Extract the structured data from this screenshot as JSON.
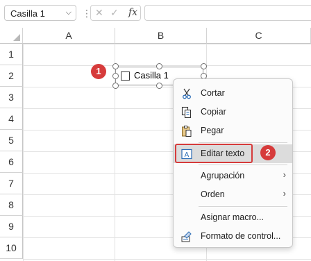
{
  "formula_bar": {
    "name_box": "Casilla 1",
    "separator": "⋮",
    "cancel": "✕",
    "enter": "✓",
    "fx": "fx",
    "formula": ""
  },
  "columns": [
    "A",
    "B",
    "C"
  ],
  "rows": [
    "1",
    "2",
    "3",
    "4",
    "5",
    "6",
    "7",
    "8",
    "9",
    "10"
  ],
  "control": {
    "label": "Casilla 1",
    "checked": false
  },
  "badges": {
    "step1": "1",
    "step2": "2"
  },
  "context_menu": {
    "cut": "Cortar",
    "copy": "Copiar",
    "paste": "Pegar",
    "edit_text": "Editar texto",
    "grouping": "Agrupación",
    "order": "Orden",
    "assign_macro": "Asignar macro...",
    "format_control": "Formato de control...",
    "submenu_arrow": "›"
  },
  "colors": {
    "badge": "#d63b3b",
    "highlight_border": "#d63b3b",
    "hover": "#dcdcdc"
  },
  "icons": {
    "cut": "scissors-icon",
    "copy": "copy-icon",
    "paste": "clipboard-icon",
    "edit_text": "text-box-icon",
    "format_control": "format-control-icon"
  }
}
